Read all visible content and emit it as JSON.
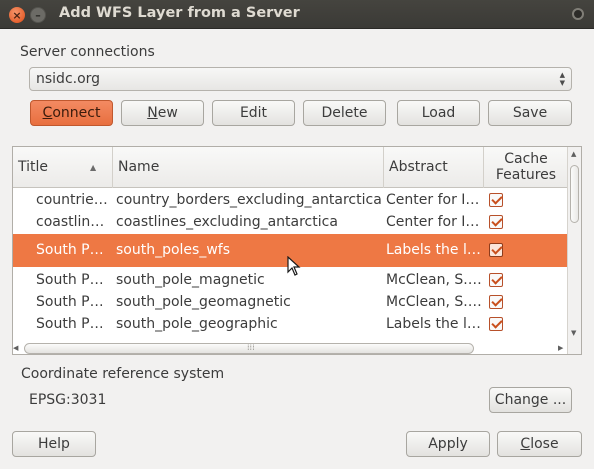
{
  "window": {
    "title": "Add WFS Layer from a Server",
    "close_glyph": "×",
    "minimize_glyph": "–"
  },
  "server_connections": {
    "label": "Server connections",
    "selected": "nsidc.org"
  },
  "buttons": {
    "connect": {
      "prefix": "",
      "underlined": "C",
      "rest": "onnect"
    },
    "new": {
      "prefix": "",
      "underlined": "N",
      "rest": "ew"
    },
    "edit": "Edit",
    "delete": "Delete",
    "load": "Load",
    "save": "Save",
    "change": "Change ...",
    "help": "Help",
    "apply": "Apply",
    "close": {
      "prefix": "",
      "underlined": "C",
      "rest": "lose"
    }
  },
  "table": {
    "columns": [
      "Title",
      "Name",
      "Abstract",
      "Cache Features"
    ],
    "cache_header_lines": [
      "Cache",
      "Features"
    ],
    "rows": [
      {
        "title": "countrie…",
        "name": "country_borders_excluding_antarctica",
        "abstract": "Center for I…",
        "cache": true,
        "selected": false
      },
      {
        "title": "coastlin…",
        "name": "coastlines_excluding_antarctica",
        "abstract": "Center for I…",
        "cache": true,
        "selected": false
      },
      {
        "title": "South P…",
        "name": "south_poles_wfs",
        "abstract": "Labels the l…",
        "cache": true,
        "selected": true
      },
      {
        "title": "South P…",
        "name": "south_pole_magnetic",
        "abstract": "McClean, S.…",
        "cache": true,
        "selected": false
      },
      {
        "title": "South P…",
        "name": "south_pole_geomagnetic",
        "abstract": "McClean, S.…",
        "cache": true,
        "selected": false
      },
      {
        "title": "South P…",
        "name": "south_pole_geographic",
        "abstract": "Labels the l…",
        "cache": true,
        "selected": false
      }
    ]
  },
  "crs": {
    "label": "Coordinate reference system",
    "value": "EPSG:3031"
  },
  "colors": {
    "accent": "#ee7844",
    "titlebar": "#3c3b37"
  }
}
